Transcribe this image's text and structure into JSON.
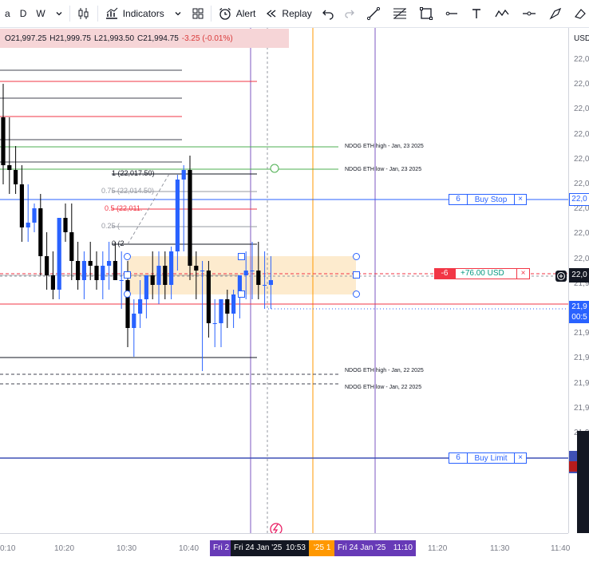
{
  "toolbar": {
    "interval_a": "a",
    "interval_d": "D",
    "interval_w": "W",
    "indicators_label": "Indicators",
    "alert_label": "Alert",
    "replay_label": "Replay"
  },
  "legend": {
    "open": "O21,997.25",
    "high": "H21,999.75",
    "low": "L21,993.50",
    "close": "C21,994.75",
    "change": "-3.25 (-0.01%)"
  },
  "price_axis": {
    "currency": "USD",
    "labels": [
      "22,0",
      "22,0",
      "22,0",
      "22,0",
      "22,0",
      "22,0",
      "22,0",
      "22,0",
      "22,0",
      "21,9",
      "21,9",
      "21,9",
      "21,9",
      "21,9",
      "21,9",
      "21,9"
    ],
    "position_price": "22,0",
    "current_price": "21,9",
    "countdown": "00:5",
    "buy_limit_tag": "2"
  },
  "time_axis": {
    "labels": [
      "0:10",
      "10:20",
      "10:30",
      "10:40",
      "11:20",
      "11:30",
      "11:40"
    ],
    "crosshair_left_prefix": "Fri 2",
    "crosshair_time_label": "Fri 24 Jan '25",
    "crosshair_time": "10:53",
    "orange_tag": "'25",
    "orange_tag_suffix": "1",
    "purple_time_label": "Fri 24 Jan '25",
    "purple_time": "11:10"
  },
  "fib": {
    "level_1": "1 (22,017.50)",
    "level_075": "0.75 (22,014.50)",
    "level_05": "0.5 (22,011.",
    "level_025": "0.25 (",
    "level_0": "0 (2"
  },
  "annotations": {
    "eth_high_23": "NDOG ETH high - Jan, 23 2025",
    "eth_low_23": "NDOG ETH low - Jan, 23 2025",
    "eth_high_22": "NDOG ETH high - Jan, 22 2025",
    "eth_low_22": "NDOG ETH low - Jan, 22 2025"
  },
  "orders": {
    "buy_stop": {
      "qty": "6",
      "label": "Buy Stop",
      "close": "×"
    },
    "buy_limit": {
      "qty": "6",
      "label": "Buy Limit",
      "close": "×"
    },
    "position": {
      "qty": "-6",
      "pnl": "+76.00 USD",
      "close": "×"
    }
  },
  "colors": {
    "bull": "#2962ff",
    "bear": "#000000",
    "accent_red": "#f23645",
    "accent_green": "#089981",
    "zone": "#fde7c6",
    "purple": "#673ab7",
    "orange": "#ff9800"
  },
  "chart_data": {
    "type": "candlestick",
    "x": [
      "10:10",
      "10:11",
      "10:12",
      "10:13",
      "10:14",
      "10:15",
      "10:16",
      "10:17",
      "10:18",
      "10:19",
      "10:20",
      "10:21",
      "10:22",
      "10:23",
      "10:24",
      "10:25",
      "10:26",
      "10:27",
      "10:28",
      "10:29",
      "10:30",
      "10:31",
      "10:32",
      "10:33",
      "10:34",
      "10:35",
      "10:36",
      "10:37",
      "10:38",
      "10:39",
      "10:40",
      "10:41",
      "10:42",
      "10:43",
      "10:44",
      "10:45",
      "10:46",
      "10:47",
      "10:48",
      "10:49",
      "10:50",
      "10:51",
      "10:52",
      "10:53"
    ],
    "open": [
      22028,
      22018,
      22017,
      22014,
      22005,
      22006,
      22009,
      21999,
      21995,
      21992,
      22007,
      22004,
      21998,
      21994,
      21998,
      21997,
      21994,
      21997,
      21998,
      21994,
      21994,
      21984,
      21987,
      21990,
      21995,
      21993,
      21997,
      21993,
      22000,
      22015,
      22017,
      21997,
      21996,
      21996,
      21985,
      21985,
      21990,
      21987,
      21991,
      21995,
      21996,
      21996,
      21993,
      21993
    ],
    "high": [
      22035,
      22028,
      22022,
      22018,
      22014,
      22010,
      22012,
      22004,
      22000,
      22002,
      22010,
      22010,
      22002,
      22000,
      22002,
      22000,
      22000,
      22002,
      22002,
      22000,
      21998,
      21990,
      21994,
      21994,
      22000,
      22000,
      22000,
      22001,
      22016,
      22018,
      22020,
      22000,
      21998,
      21998,
      21990,
      21990,
      21992,
      21992,
      21994,
      22000,
      22002,
      22002,
      22000,
      21999
    ],
    "low": [
      22014,
      22012,
      22012,
      22002,
      22002,
      22004,
      21995,
      21992,
      21990,
      21990,
      22002,
      21994,
      21992,
      21990,
      21994,
      21992,
      21990,
      21992,
      21994,
      21988,
      21980,
      21978,
      21984,
      21986,
      21990,
      21989,
      21990,
      21990,
      21996,
      22000,
      21994,
      21990,
      21975,
      21982,
      21980,
      21980,
      21984,
      21984,
      21986,
      21990,
      21990,
      21990,
      21988,
      21988
    ],
    "close": [
      22018,
      22017,
      22014,
      22005,
      22006,
      22009,
      21999,
      21995,
      21992,
      22007,
      22004,
      21998,
      21994,
      21998,
      21997,
      21994,
      21997,
      21998,
      21994,
      21994,
      21984,
      21987,
      21990,
      21995,
      21993,
      21997,
      21993,
      22000,
      22015,
      22017,
      21997,
      21996,
      21996,
      21985,
      21985,
      21990,
      21987,
      21991,
      21995,
      21996,
      21996,
      21993,
      21993,
      21994
    ],
    "ylim": [
      21960,
      22040
    ]
  }
}
